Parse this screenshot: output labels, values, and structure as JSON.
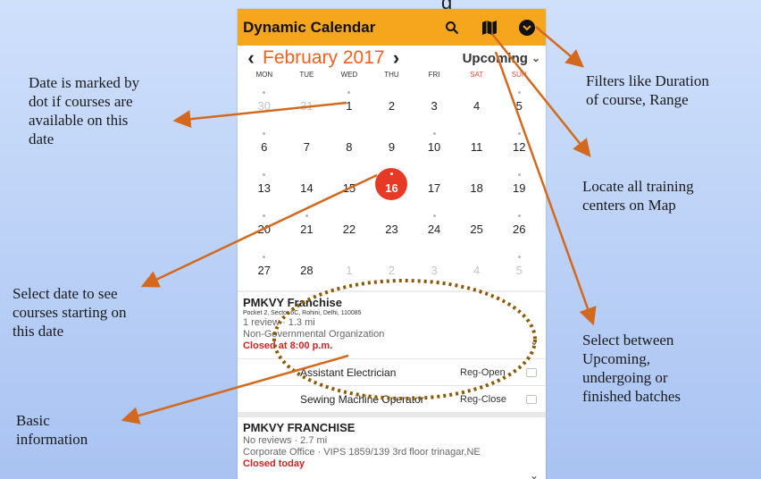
{
  "top_partial_text": "g",
  "app": {
    "title": "Dynamic Calendar",
    "icons": [
      "search-icon",
      "map-icon",
      "filter-icon"
    ],
    "accent_color": "#f5a61d"
  },
  "calendar": {
    "prev_label": "‹",
    "next_label": "›",
    "month": "February 2017",
    "batch_filter": "Upcoming",
    "batch_chevron": "⌄",
    "weekdays": [
      "MON",
      "TUE",
      "WED",
      "THU",
      "FRI",
      "SAT",
      "SUN"
    ],
    "selected_day": "16",
    "selected_color": "#e63a26",
    "weeks": [
      [
        {
          "d": "30",
          "faded": true,
          "dot": true
        },
        {
          "d": "31",
          "faded": true,
          "dot": false
        },
        {
          "d": "1",
          "faded": false,
          "dot": true
        },
        {
          "d": "2",
          "faded": false,
          "dot": false
        },
        {
          "d": "3",
          "faded": false,
          "dot": false
        },
        {
          "d": "4",
          "faded": false,
          "dot": false
        },
        {
          "d": "5",
          "faded": false,
          "dot": true
        }
      ],
      [
        {
          "d": "6",
          "faded": false,
          "dot": true
        },
        {
          "d": "7",
          "faded": false,
          "dot": false
        },
        {
          "d": "8",
          "faded": false,
          "dot": false
        },
        {
          "d": "9",
          "faded": false,
          "dot": false
        },
        {
          "d": "10",
          "faded": false,
          "dot": true
        },
        {
          "d": "11",
          "faded": false,
          "dot": false
        },
        {
          "d": "12",
          "faded": false,
          "dot": true
        }
      ],
      [
        {
          "d": "13",
          "faded": false,
          "dot": true
        },
        {
          "d": "14",
          "faded": false,
          "dot": false
        },
        {
          "d": "15",
          "faded": false,
          "dot": false
        },
        {
          "d": "16",
          "faded": false,
          "dot": true,
          "selected": true
        },
        {
          "d": "17",
          "faded": false,
          "dot": false
        },
        {
          "d": "18",
          "faded": false,
          "dot": false
        },
        {
          "d": "19",
          "faded": false,
          "dot": true
        }
      ],
      [
        {
          "d": "20",
          "faded": false,
          "dot": true
        },
        {
          "d": "21",
          "faded": false,
          "dot": true
        },
        {
          "d": "22",
          "faded": false,
          "dot": false
        },
        {
          "d": "23",
          "faded": false,
          "dot": false
        },
        {
          "d": "24",
          "faded": false,
          "dot": true
        },
        {
          "d": "25",
          "faded": false,
          "dot": false
        },
        {
          "d": "26",
          "faded": false,
          "dot": true
        }
      ],
      [
        {
          "d": "27",
          "faded": false,
          "dot": true
        },
        {
          "d": "28",
          "faded": false,
          "dot": false
        },
        {
          "d": "1",
          "faded": true,
          "dot": false
        },
        {
          "d": "2",
          "faded": true,
          "dot": false
        },
        {
          "d": "3",
          "faded": true,
          "dot": false
        },
        {
          "d": "4",
          "faded": true,
          "dot": false
        },
        {
          "d": "5",
          "faded": true,
          "dot": true
        }
      ]
    ]
  },
  "centers": [
    {
      "name": "PMKVY Franchise",
      "address": "Pocket 2, Sector 6C, Rohini, Delhi, 110085",
      "reviews": "1 review · 1.3 mi",
      "type": "Non-Governmental Organization",
      "status": "Closed at 8:00 p.m.",
      "courses": [
        {
          "name": "Assistant Electrician",
          "status": "Reg-Open"
        },
        {
          "name": "Sewing Machine Operator",
          "status": "Reg-Close"
        }
      ]
    },
    {
      "name": "PMKVY FRANCHISE",
      "reviews": "No reviews · 2.7 mi",
      "address": "Corporate Office · VIPS 1859/139 3rd floor trinagar,NE",
      "status": "Closed today"
    }
  ],
  "annotations": {
    "dot_marked": [
      "Date is marked by",
      "dot if courses are",
      "available on this",
      "date"
    ],
    "select_date": [
      "Select  date to see",
      "courses starting on",
      "this date"
    ],
    "basic_info": [
      "Basic",
      "information"
    ],
    "filters": [
      "Filters like Duration",
      "of course, Range"
    ],
    "map": [
      "Locate all training",
      "centers on Map"
    ],
    "batches": [
      "Select between",
      "Upcoming,",
      "undergoing or",
      "finished  batches"
    ]
  },
  "colors": {
    "arrow": "#d2691e",
    "dashed_ellipse": "#8b5a00",
    "status_closed": "#d32222"
  }
}
